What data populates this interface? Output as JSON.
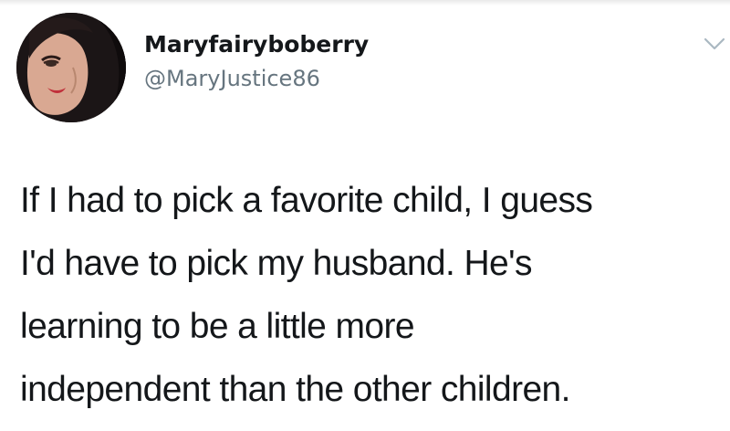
{
  "user": {
    "display_name": "Maryfairyboberry",
    "handle": "@MaryJustice86"
  },
  "icons": {
    "avatar": "profile-photo",
    "menu": "chevron-down-icon"
  },
  "tweet": {
    "lines": [
      "If I had to pick a favorite child, I guess",
      "I'd have to pick my husband. He's",
      "learning to be a little more",
      "independent than the other children."
    ]
  },
  "colors": {
    "name": "#14171a",
    "handle": "#66757f",
    "text": "#14171a",
    "caret": "#aab8c2"
  }
}
